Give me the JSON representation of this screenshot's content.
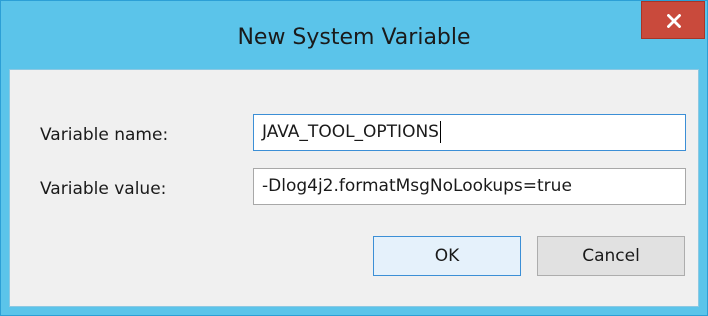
{
  "window": {
    "title": "New System Variable"
  },
  "form": {
    "name_label": "Variable name:",
    "name_value": "JAVA_TOOL_OPTIONS",
    "value_label": "Variable value:",
    "value_value": "-Dlog4j2.formatMsgNoLookups=true"
  },
  "buttons": {
    "ok": "OK",
    "cancel": "Cancel"
  },
  "icons": {
    "close": "close-icon"
  },
  "colors": {
    "titlebar": "#5bc4ea",
    "close_button": "#c94a3c",
    "client_area": "#f0f0f0"
  }
}
